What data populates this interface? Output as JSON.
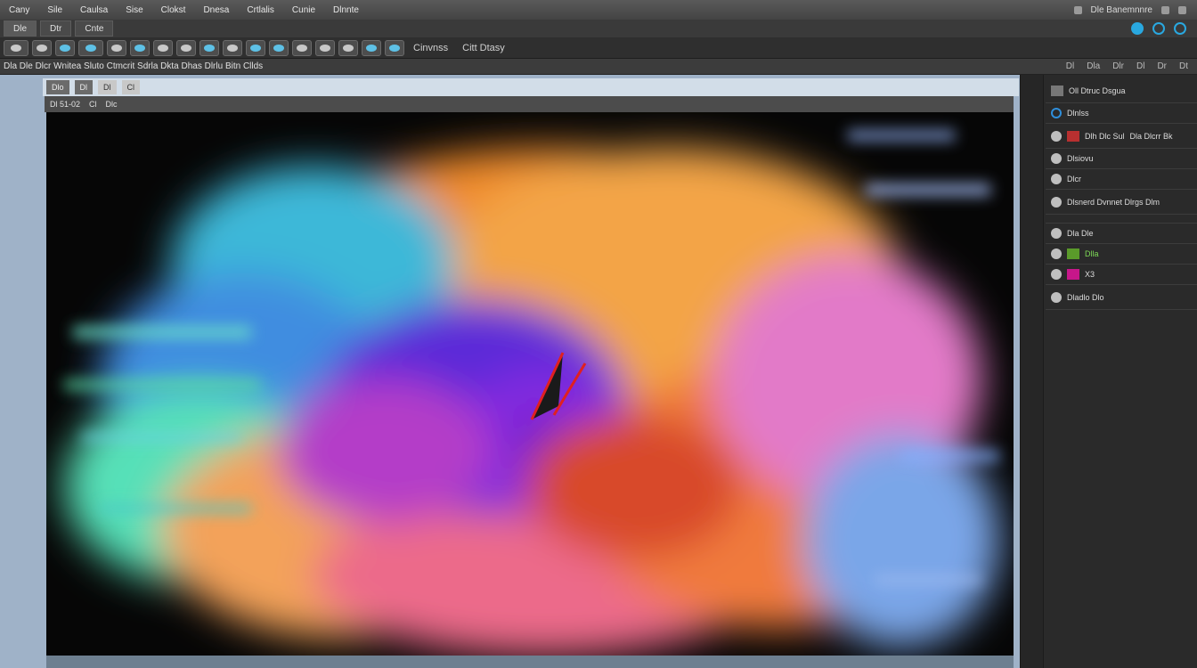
{
  "app": {
    "menu": [
      "Cany",
      "Sile",
      "Caulsa",
      "Sise",
      "Clokst",
      "Dnesa",
      "Crtlalis",
      "Cunie",
      "Dlnnte"
    ],
    "menu_right": "Dle Banemnnre"
  },
  "toolbar": {
    "tabs": [
      "Dle",
      "Dtr",
      "Cnte"
    ],
    "right_icons": [
      "refresh-icon",
      "globe-icon",
      "settings-icon"
    ]
  },
  "iconbar": {
    "label1": "Cinvnss",
    "label2": "Citt Dtasy"
  },
  "options": {
    "text": "Dla Dle Dlcr Wnitea Sluto Ctmcrit Sdrla Dkta Dhas Dlrlu Bitn Cllds",
    "right": [
      "Dl",
      "Dla",
      "Dlr",
      "Dl",
      "Dr",
      "Dt"
    ]
  },
  "document": {
    "tabs": [
      "Dlo",
      "Dl",
      "Dl",
      "Cl"
    ],
    "subbar": [
      "Dl 51-02",
      "Cl",
      "Dlc"
    ]
  },
  "panel": {
    "header": "Oll Dtruc Dsgua",
    "rows": [
      {
        "label": "Dlnlss"
      },
      {
        "label": "Dlh Dlc Sul",
        "sub": "Dla Dlcrr Bk"
      },
      {
        "label": "Dlsiovu"
      },
      {
        "label": "Dlcr"
      },
      {
        "label": "Dlsnerd Dvnnet Dlrgs Dlm"
      },
      {
        "label": "Dla Dle"
      },
      {
        "label": "Dlla"
      },
      {
        "label": "X3"
      },
      {
        "label": "Dladlo Dlo"
      }
    ]
  },
  "colors": {
    "accent": "#29a8e0",
    "workspace": "#9fb2c8",
    "panel": "#2a2a2a"
  }
}
